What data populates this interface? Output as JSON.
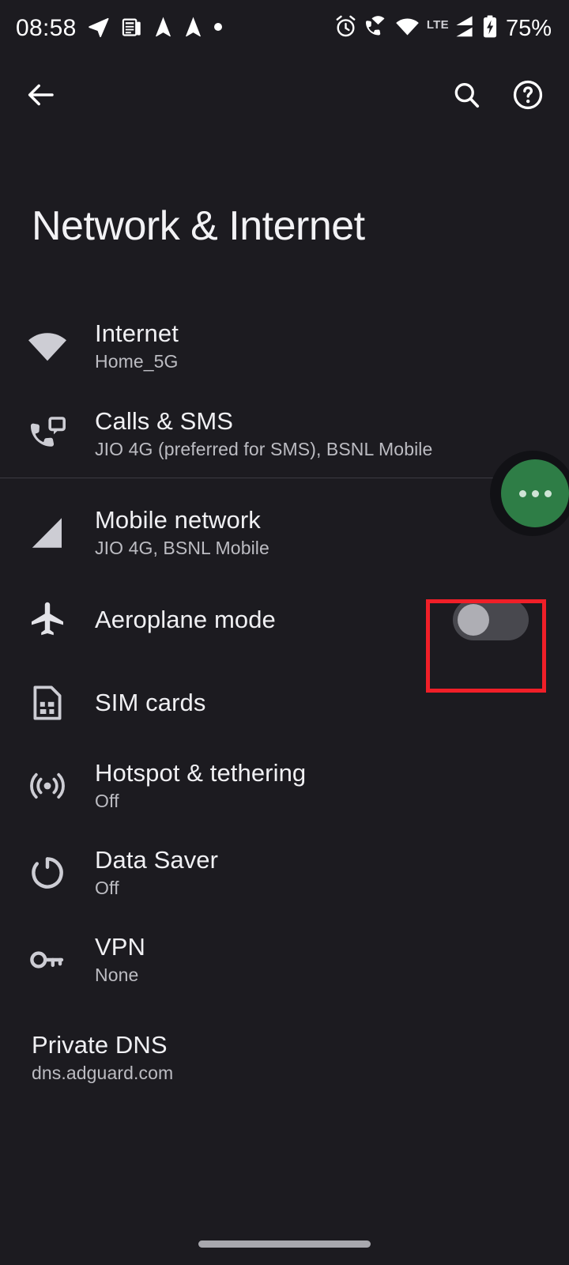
{
  "status_bar": {
    "time": "08:58",
    "battery_percent": "75%",
    "network_label": "LTE",
    "left_icons": [
      "telegram-plane-icon",
      "news-document-icon",
      "paper-plane-icon",
      "paper-plane-icon",
      "dot-icon"
    ],
    "right_icons": [
      "alarm-clock-icon",
      "wifi-calling-icon",
      "wifi-icon",
      "signal-lte-icon",
      "signal-bars-icon",
      "battery-charging-icon"
    ]
  },
  "action_bar": {
    "back_label": "back-arrow-icon",
    "search_label": "search-icon",
    "help_label": "help-circle-icon"
  },
  "header": {
    "title": "Network & Internet"
  },
  "fab": {
    "name": "overflow-menu-fab",
    "color": "#2e7d46"
  },
  "highlight": {
    "color": "#f01f28",
    "target": "aeroplane-mode-toggle"
  },
  "settings": [
    {
      "id": "internet",
      "icon": "wifi-icon",
      "title": "Internet",
      "subtitle": "Home_5G"
    },
    {
      "id": "calls-sms",
      "icon": "calls-sms-icon",
      "title": "Calls & SMS",
      "subtitle": "JIO 4G (preferred for SMS), BSNL Mobile"
    },
    {
      "id": "mobile-network",
      "icon": "signal-bars-icon",
      "title": "Mobile network",
      "subtitle": "JIO 4G, BSNL Mobile"
    },
    {
      "id": "aeroplane-mode",
      "icon": "airplane-icon",
      "title": "Aeroplane mode",
      "subtitle": "",
      "toggle_state": "off"
    },
    {
      "id": "sim-cards",
      "icon": "sim-card-icon",
      "title": "SIM cards",
      "subtitle": ""
    },
    {
      "id": "hotspot-tethering",
      "icon": "hotspot-icon",
      "title": "Hotspot & tethering",
      "subtitle": "Off"
    },
    {
      "id": "data-saver",
      "icon": "data-saver-icon",
      "title": "Data Saver",
      "subtitle": "Off"
    },
    {
      "id": "vpn",
      "icon": "key-icon",
      "title": "VPN",
      "subtitle": "None"
    },
    {
      "id": "private-dns",
      "icon": "",
      "title": "Private DNS",
      "subtitle": "dns.adguard.com"
    }
  ],
  "nav_bar": {
    "pill": "home-gesture-pill"
  }
}
